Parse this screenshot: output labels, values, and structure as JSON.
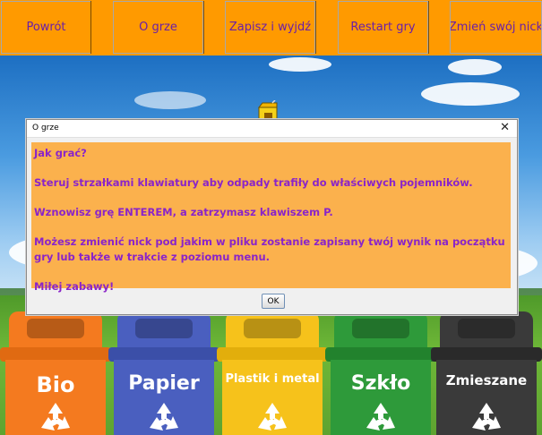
{
  "menu": {
    "items": [
      {
        "label": "Powrót"
      },
      {
        "label": "O grze"
      },
      {
        "label": "Zapisz i wyjdź"
      },
      {
        "label": "Restart gry"
      },
      {
        "label": "Zmień swój nick"
      }
    ]
  },
  "dialog": {
    "title": "O grze",
    "close_symbol": "✕",
    "lines": [
      "Jak grać?",
      "Steruj strzałkami klawiatury aby odpady trafiły do właściwych pojemników.",
      "Wznowisz grę ENTEREM, a zatrzymasz klawiszem P.",
      "Możesz zmienić nick pod jakim w pliku zostanie zapisany twój wynik na początku gry lub także w trakcie z poziomu menu.",
      "Miłej zabawy!"
    ],
    "ok_label": "OK",
    "colors": {
      "message_bg": "#fbb14d",
      "message_text": "#8a24c9"
    }
  },
  "bins": [
    {
      "label": "Bio",
      "color": "#f47a1f",
      "icon": "recycle-icon"
    },
    {
      "label": "Papier",
      "color": "#4a5fbf",
      "icon": "recycle-icon"
    },
    {
      "label": "Plastik i metal",
      "color": "#f6c21b",
      "icon": "recycle-icon"
    },
    {
      "label": "Szkło",
      "color": "#2e9a3a",
      "icon": "recycle-icon"
    },
    {
      "label": "Zmieszane",
      "color": "#3a3a3a",
      "icon": "recycle-icon"
    }
  ],
  "falling_item": {
    "icon": "juice-box-icon"
  },
  "colors": {
    "menu_bg": "#ff9a00",
    "menu_text": "#6a1fa8"
  }
}
